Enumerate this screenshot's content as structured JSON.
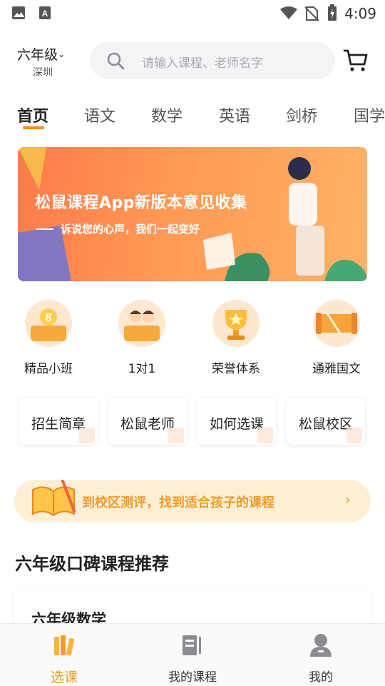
{
  "status_bar": {
    "time": "4:09"
  },
  "header": {
    "grade": "六年级",
    "city": "深圳",
    "search_placeholder": "请输入课程、老师名字"
  },
  "tabs": [
    "首页",
    "语文",
    "数学",
    "英语",
    "剑桥",
    "国学"
  ],
  "banner": {
    "title": "松鼠课程App新版本意见收集",
    "subtitle": "诉说您的心声，我们一起变好"
  },
  "features": [
    {
      "label": "精品小班",
      "icon": "small-class-icon"
    },
    {
      "label": "1对1",
      "icon": "one-on-one-icon"
    },
    {
      "label": "荣誉体系",
      "icon": "trophy-icon"
    },
    {
      "label": "通雅国文",
      "icon": "scroll-icon"
    }
  ],
  "cards": [
    "招生简章",
    "松鼠老师",
    "如何选课",
    "松鼠校区"
  ],
  "eval": {
    "label": "到校区测评，找到适合孩子的课程"
  },
  "section_title": "六年级口碑课程推荐",
  "course_preview": {
    "title": "六年级数学"
  },
  "bottom_nav": [
    {
      "label": "选课",
      "icon": "books-icon",
      "active": true
    },
    {
      "label": "我的课程",
      "icon": "my-course-icon",
      "active": false
    },
    {
      "label": "我的",
      "icon": "profile-icon",
      "active": false
    }
  ],
  "colors": {
    "accent": "#ff8a1f",
    "eval_text": "#f29a2a"
  }
}
